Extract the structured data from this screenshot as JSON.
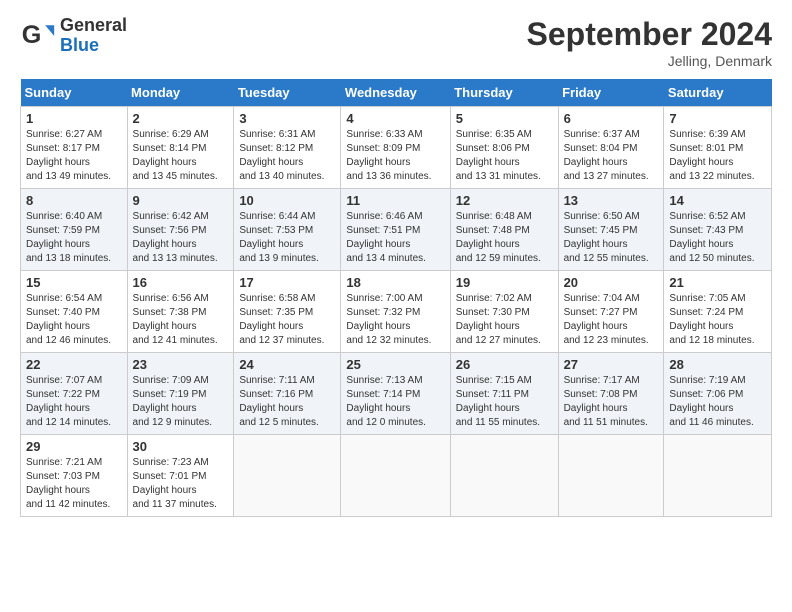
{
  "logo": {
    "general": "General",
    "blue": "Blue"
  },
  "header": {
    "title": "September 2024",
    "location": "Jelling, Denmark"
  },
  "weekdays": [
    "Sunday",
    "Monday",
    "Tuesday",
    "Wednesday",
    "Thursday",
    "Friday",
    "Saturday"
  ],
  "weeks": [
    [
      {
        "day": "1",
        "sunrise": "6:27 AM",
        "sunset": "8:17 PM",
        "daylight": "13 hours and 49 minutes."
      },
      {
        "day": "2",
        "sunrise": "6:29 AM",
        "sunset": "8:14 PM",
        "daylight": "13 hours and 45 minutes."
      },
      {
        "day": "3",
        "sunrise": "6:31 AM",
        "sunset": "8:12 PM",
        "daylight": "13 hours and 40 minutes."
      },
      {
        "day": "4",
        "sunrise": "6:33 AM",
        "sunset": "8:09 PM",
        "daylight": "13 hours and 36 minutes."
      },
      {
        "day": "5",
        "sunrise": "6:35 AM",
        "sunset": "8:06 PM",
        "daylight": "13 hours and 31 minutes."
      },
      {
        "day": "6",
        "sunrise": "6:37 AM",
        "sunset": "8:04 PM",
        "daylight": "13 hours and 27 minutes."
      },
      {
        "day": "7",
        "sunrise": "6:39 AM",
        "sunset": "8:01 PM",
        "daylight": "13 hours and 22 minutes."
      }
    ],
    [
      {
        "day": "8",
        "sunrise": "6:40 AM",
        "sunset": "7:59 PM",
        "daylight": "13 hours and 18 minutes."
      },
      {
        "day": "9",
        "sunrise": "6:42 AM",
        "sunset": "7:56 PM",
        "daylight": "13 hours and 13 minutes."
      },
      {
        "day": "10",
        "sunrise": "6:44 AM",
        "sunset": "7:53 PM",
        "daylight": "13 hours and 9 minutes."
      },
      {
        "day": "11",
        "sunrise": "6:46 AM",
        "sunset": "7:51 PM",
        "daylight": "13 hours and 4 minutes."
      },
      {
        "day": "12",
        "sunrise": "6:48 AM",
        "sunset": "7:48 PM",
        "daylight": "12 hours and 59 minutes."
      },
      {
        "day": "13",
        "sunrise": "6:50 AM",
        "sunset": "7:45 PM",
        "daylight": "12 hours and 55 minutes."
      },
      {
        "day": "14",
        "sunrise": "6:52 AM",
        "sunset": "7:43 PM",
        "daylight": "12 hours and 50 minutes."
      }
    ],
    [
      {
        "day": "15",
        "sunrise": "6:54 AM",
        "sunset": "7:40 PM",
        "daylight": "12 hours and 46 minutes."
      },
      {
        "day": "16",
        "sunrise": "6:56 AM",
        "sunset": "7:38 PM",
        "daylight": "12 hours and 41 minutes."
      },
      {
        "day": "17",
        "sunrise": "6:58 AM",
        "sunset": "7:35 PM",
        "daylight": "12 hours and 37 minutes."
      },
      {
        "day": "18",
        "sunrise": "7:00 AM",
        "sunset": "7:32 PM",
        "daylight": "12 hours and 32 minutes."
      },
      {
        "day": "19",
        "sunrise": "7:02 AM",
        "sunset": "7:30 PM",
        "daylight": "12 hours and 27 minutes."
      },
      {
        "day": "20",
        "sunrise": "7:04 AM",
        "sunset": "7:27 PM",
        "daylight": "12 hours and 23 minutes."
      },
      {
        "day": "21",
        "sunrise": "7:05 AM",
        "sunset": "7:24 PM",
        "daylight": "12 hours and 18 minutes."
      }
    ],
    [
      {
        "day": "22",
        "sunrise": "7:07 AM",
        "sunset": "7:22 PM",
        "daylight": "12 hours and 14 minutes."
      },
      {
        "day": "23",
        "sunrise": "7:09 AM",
        "sunset": "7:19 PM",
        "daylight": "12 hours and 9 minutes."
      },
      {
        "day": "24",
        "sunrise": "7:11 AM",
        "sunset": "7:16 PM",
        "daylight": "12 hours and 5 minutes."
      },
      {
        "day": "25",
        "sunrise": "7:13 AM",
        "sunset": "7:14 PM",
        "daylight": "12 hours and 0 minutes."
      },
      {
        "day": "26",
        "sunrise": "7:15 AM",
        "sunset": "7:11 PM",
        "daylight": "11 hours and 55 minutes."
      },
      {
        "day": "27",
        "sunrise": "7:17 AM",
        "sunset": "7:08 PM",
        "daylight": "11 hours and 51 minutes."
      },
      {
        "day": "28",
        "sunrise": "7:19 AM",
        "sunset": "7:06 PM",
        "daylight": "11 hours and 46 minutes."
      }
    ],
    [
      {
        "day": "29",
        "sunrise": "7:21 AM",
        "sunset": "7:03 PM",
        "daylight": "11 hours and 42 minutes."
      },
      {
        "day": "30",
        "sunrise": "7:23 AM",
        "sunset": "7:01 PM",
        "daylight": "11 hours and 37 minutes."
      },
      null,
      null,
      null,
      null,
      null
    ]
  ]
}
